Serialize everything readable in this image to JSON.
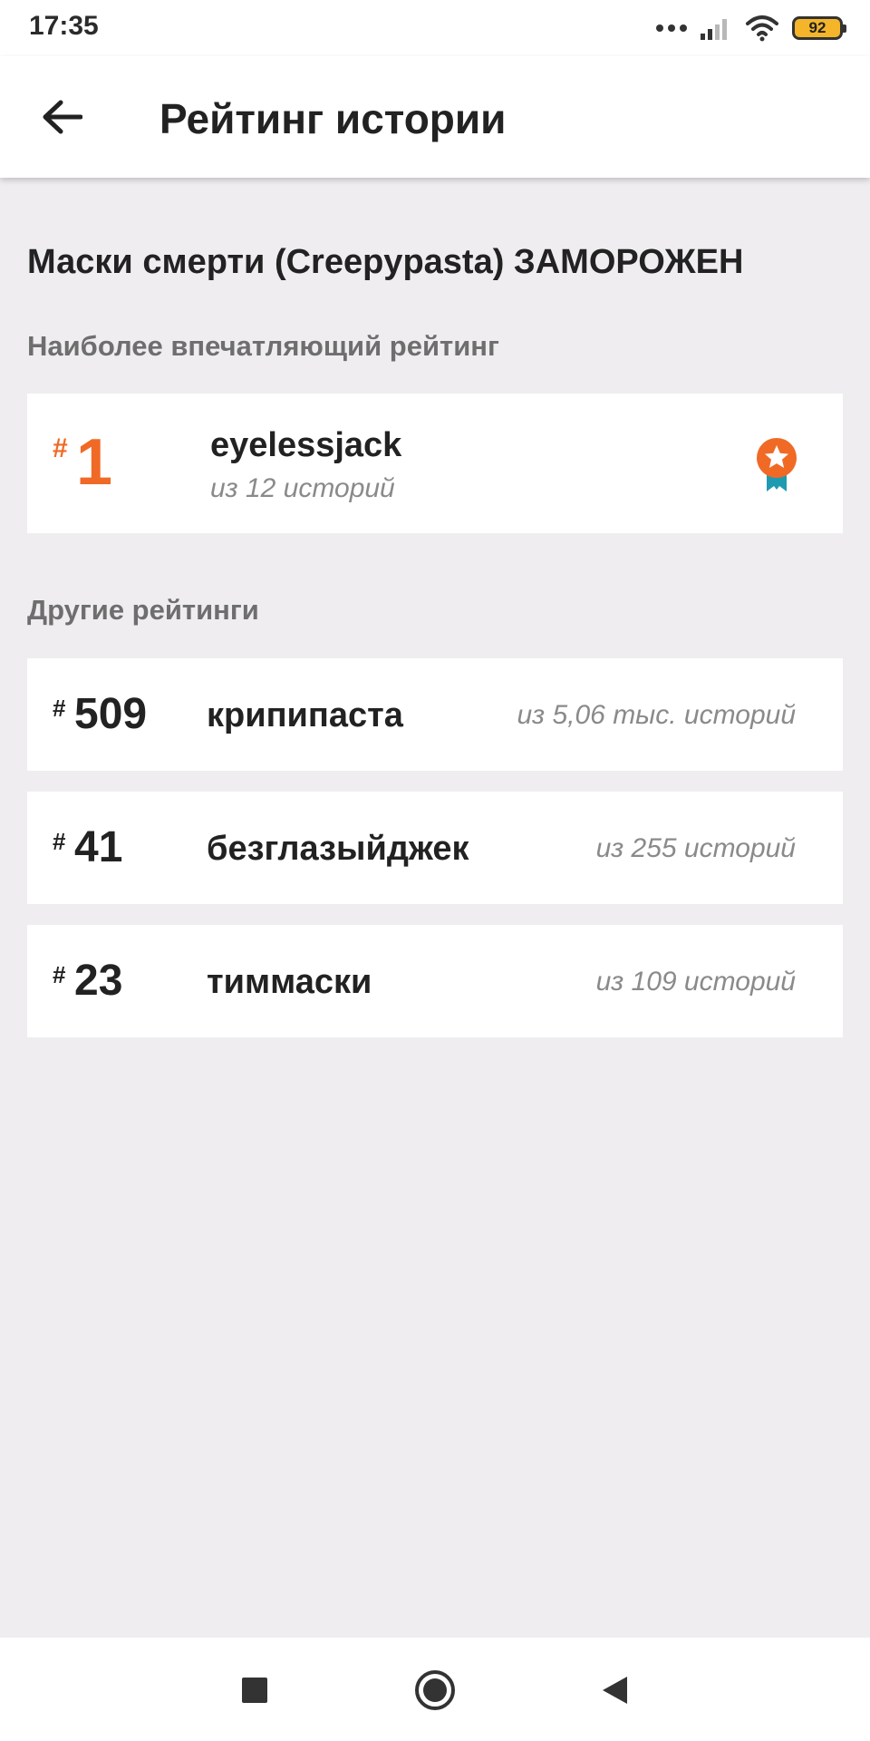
{
  "status_bar": {
    "time": "17:35",
    "battery_level": "92",
    "icons": [
      "more-dots-icon",
      "signal-icon",
      "wifi-icon",
      "battery-icon"
    ]
  },
  "app_bar": {
    "title": "Рейтинг истории",
    "back_icon": "arrow-left-icon"
  },
  "story": {
    "title": "Маски смерти (Creepypasta) ЗАМОРОЖЕН"
  },
  "top_ranking": {
    "section_label": "Наиболее впечатляющий рейтинг",
    "hash": "#",
    "rank": "1",
    "tag": "eyelessjack",
    "count": "из 12 историй",
    "icon": "award-ribbon-icon"
  },
  "other_rankings": {
    "section_label": "Другие рейтинги",
    "items": [
      {
        "hash": "#",
        "rank": "509",
        "tag": "крипипаста",
        "count": "из 5,06 тыс. историй"
      },
      {
        "hash": "#",
        "rank": "41",
        "tag": "безглазыйджек",
        "count": "из 255 историй"
      },
      {
        "hash": "#",
        "rank": "23",
        "tag": "тиммаски",
        "count": "из 109 историй"
      }
    ]
  },
  "nav_bar": {
    "buttons": [
      "square-recents-icon",
      "circle-home-icon",
      "triangle-back-icon"
    ]
  },
  "colors": {
    "accent": "#f06a26",
    "badge_teal": "#1e9bb0",
    "background": "#efedf0",
    "card": "#ffffff",
    "battery": "#f4b52a"
  }
}
